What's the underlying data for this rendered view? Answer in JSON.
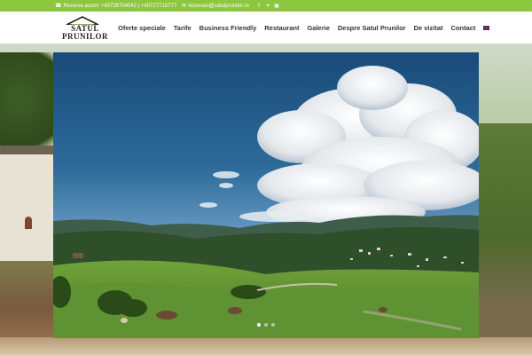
{
  "topbar": {
    "phone_icon": "phone-icon",
    "reserve_label": "Rezerva acum!",
    "phones": "+40726704042 | +40727715777",
    "email_icon": "envelope-icon",
    "email": "rezervari@satulprunilor.ro",
    "social": [
      "facebook-icon",
      "twitter-icon",
      "instagram-icon"
    ]
  },
  "logo": {
    "line1": "SATUL",
    "line2": "PRUNILOR"
  },
  "nav": {
    "items": [
      "Oferte speciale",
      "Tarife",
      "Business Friendly",
      "Restaurant",
      "Galerie",
      "Despre Satul Prunilor",
      "De vizitat",
      "Contact"
    ],
    "language_flag": "uk-flag-icon"
  },
  "slider": {
    "slide_count": 3,
    "active_index": 0
  },
  "colors": {
    "topbar": "#8dc63f",
    "header": "#ffffff",
    "nav_text": "#333333"
  }
}
